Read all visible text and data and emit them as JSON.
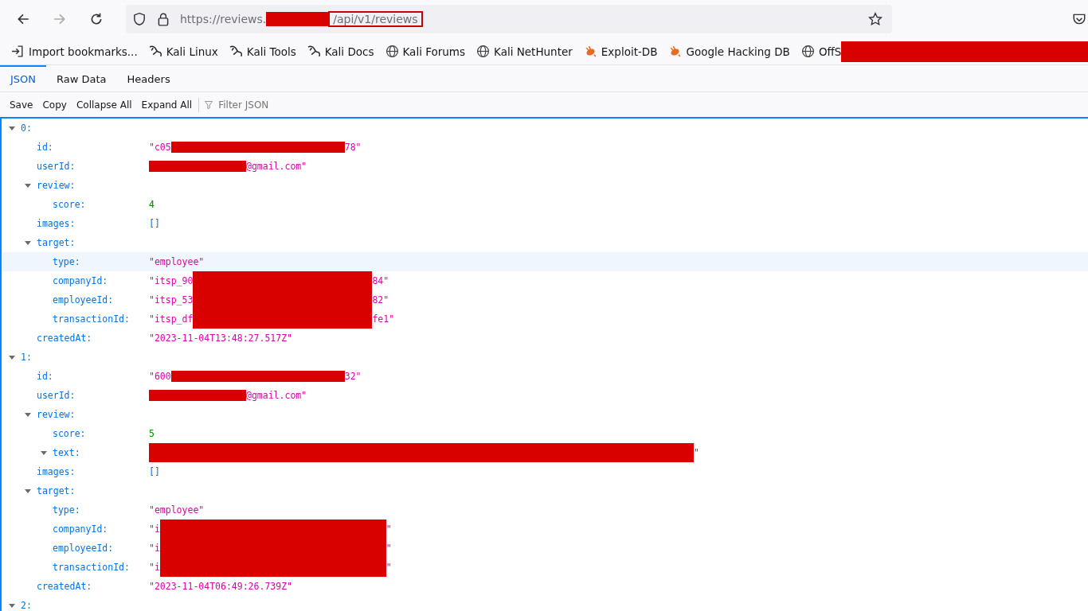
{
  "browser": {
    "nav": {
      "back_disabled": false,
      "forward_disabled": true
    },
    "url": {
      "prefix": "https://reviews.",
      "redacted": true,
      "boxed": "/api/v1/reviews"
    },
    "bookmarks": [
      {
        "label": "Import bookmarks...",
        "redacted": false
      },
      {
        "label": "Kali Linux",
        "redacted": false
      },
      {
        "label": "Kali Tools",
        "redacted": false
      },
      {
        "label": "Kali Docs",
        "redacted": false
      },
      {
        "label": "Kali Forums",
        "redacted": false
      },
      {
        "label": "Kali NetHunter",
        "redacted": false
      },
      {
        "label": "Exploit-DB",
        "redacted": false
      },
      {
        "label": "Google Hacking DB",
        "redacted": false
      },
      {
        "label": "OffS",
        "redacted": true
      }
    ]
  },
  "viewer": {
    "tabs": [
      {
        "label": "JSON",
        "selected": true
      },
      {
        "label": "Raw Data",
        "selected": false
      },
      {
        "label": "Headers",
        "selected": false
      }
    ],
    "toolbar": [
      "Save",
      "Copy",
      "Collapse All",
      "Expand All"
    ],
    "filter": {
      "placeholder": "Filter JSON"
    }
  },
  "tree": [
    {
      "key": "0:",
      "expanded": true,
      "selected": false,
      "children": [
        {
          "key": "id:",
          "kind": "string",
          "value": "\"c05",
          "redacted": true,
          "value_end": "78\"",
          "selected": false
        },
        {
          "key": "userId:",
          "kind": "string",
          "redacted": true,
          "value_end": "@gmail.com\"",
          "selected": false
        },
        {
          "key": "review:",
          "expanded": true,
          "selected": false,
          "children": [
            {
              "key": "score:",
              "kind": "number",
              "value": "4",
              "selected": false
            }
          ]
        },
        {
          "key": "images:",
          "kind": "array",
          "value": "[]",
          "selected": false
        },
        {
          "key": "target:",
          "expanded": true,
          "selected": false,
          "children": [
            {
              "key": "type:",
              "kind": "string",
              "value": "\"employee\"",
              "selected": true
            },
            {
              "key": "companyId:",
              "kind": "string",
              "value": "\"itsp_90",
              "redacted": true,
              "value_end": "84\"",
              "selected": false
            },
            {
              "key": "employeeId:",
              "kind": "string",
              "value": "\"itsp_53",
              "redacted": true,
              "value_end": "82\"",
              "selected": false
            },
            {
              "key": "transactionId:",
              "kind": "string",
              "value": "\"itsp_df",
              "redacted": true,
              "value_end": "fe1\"",
              "selected": false
            }
          ]
        },
        {
          "key": "createdAt:",
          "kind": "string",
          "value": "\"2023-11-04T13:48:27.517Z\"",
          "selected": false
        }
      ]
    },
    {
      "key": "1:",
      "expanded": true,
      "selected": false,
      "children": [
        {
          "key": "id:",
          "kind": "string",
          "value": "\"600",
          "redacted": true,
          "value_end": "32\"",
          "selected": false
        },
        {
          "key": "userId:",
          "kind": "string",
          "redacted": true,
          "value_end": "@gmail.com\"",
          "selected": false
        },
        {
          "key": "review:",
          "expanded": true,
          "selected": false,
          "children": [
            {
              "key": "score:",
              "kind": "number",
              "value": "5",
              "selected": false
            },
            {
              "key": "text:",
              "kind": "string",
              "expanded": true,
              "redacted": true,
              "value_end": "\"",
              "selected": false
            }
          ]
        },
        {
          "key": "images:",
          "kind": "array",
          "value": "[]",
          "selected": false
        },
        {
          "key": "target:",
          "expanded": true,
          "selected": false,
          "children": [
            {
              "key": "type:",
              "kind": "string",
              "value": "\"employee\"",
              "selected": false
            },
            {
              "key": "companyId:",
              "kind": "string",
              "value": "\"i",
              "redacted": true,
              "value_end": "\"",
              "selected": false
            },
            {
              "key": "employeeId:",
              "kind": "string",
              "value": "\"i",
              "redacted": true,
              "value_end": "\"",
              "selected": false
            },
            {
              "key": "transactionId:",
              "kind": "string",
              "value": "\"i",
              "redacted": true,
              "value_end": "\"",
              "selected": false
            }
          ]
        },
        {
          "key": "createdAt:",
          "kind": "string",
          "value": "\"2023-11-04T06:49:26.739Z\"",
          "selected": false
        }
      ]
    },
    {
      "key": "2:",
      "expanded": true,
      "selected": false
    }
  ]
}
